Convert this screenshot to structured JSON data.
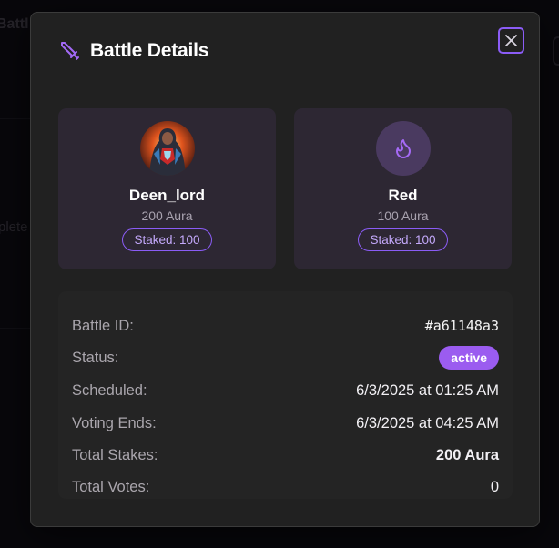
{
  "background": {
    "title_fragment": "Battl",
    "side_fragment": "plete"
  },
  "modal": {
    "title": "Battle Details",
    "icons": {
      "title_icon": "sword-icon",
      "close_icon": "close-icon"
    },
    "accent_color": "#8b5cf6"
  },
  "players": [
    {
      "name": "Deen_lord",
      "aura": "200 Aura",
      "staked": "Staked: 100",
      "avatar": "hero-avatar"
    },
    {
      "name": "Red",
      "aura": "100 Aura",
      "staked": "Staked: 100",
      "avatar": "flame-icon"
    }
  ],
  "details": {
    "battle_id_label": "Battle ID:",
    "battle_id": "#a61148a3",
    "status_label": "Status:",
    "status": "active",
    "scheduled_label": "Scheduled:",
    "scheduled": "6/3/2025 at 01:25 AM",
    "voting_ends_label": "Voting Ends:",
    "voting_ends": "6/3/2025 at 04:25 AM",
    "total_stakes_label": "Total Stakes:",
    "total_stakes": "200 Aura",
    "total_votes_label": "Total Votes:",
    "total_votes": "0"
  }
}
